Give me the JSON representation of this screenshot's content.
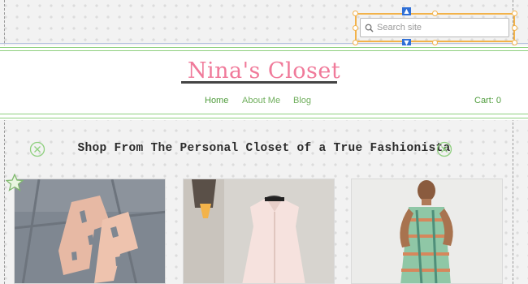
{
  "search": {
    "placeholder": "Search site",
    "value": ""
  },
  "brand": {
    "title": "Nina's Closet"
  },
  "nav": {
    "items": [
      {
        "label": "Home",
        "active": true
      },
      {
        "label": "About Me",
        "active": false
      },
      {
        "label": "Blog",
        "active": false
      }
    ]
  },
  "cart": {
    "label": "Cart: 0"
  },
  "tagline": "Shop From The Personal Closet of a True Fashionista",
  "products": [
    {
      "icon": "sandals-photo"
    },
    {
      "icon": "sleeveless-blouse-photo"
    },
    {
      "icon": "printed-dress-photo"
    }
  ],
  "colors": {
    "accent_green": "#6fae5c",
    "brand_pink": "#f07a9a",
    "selection_orange": "#f2b24a",
    "anchor_blue": "#2f6fd6"
  }
}
